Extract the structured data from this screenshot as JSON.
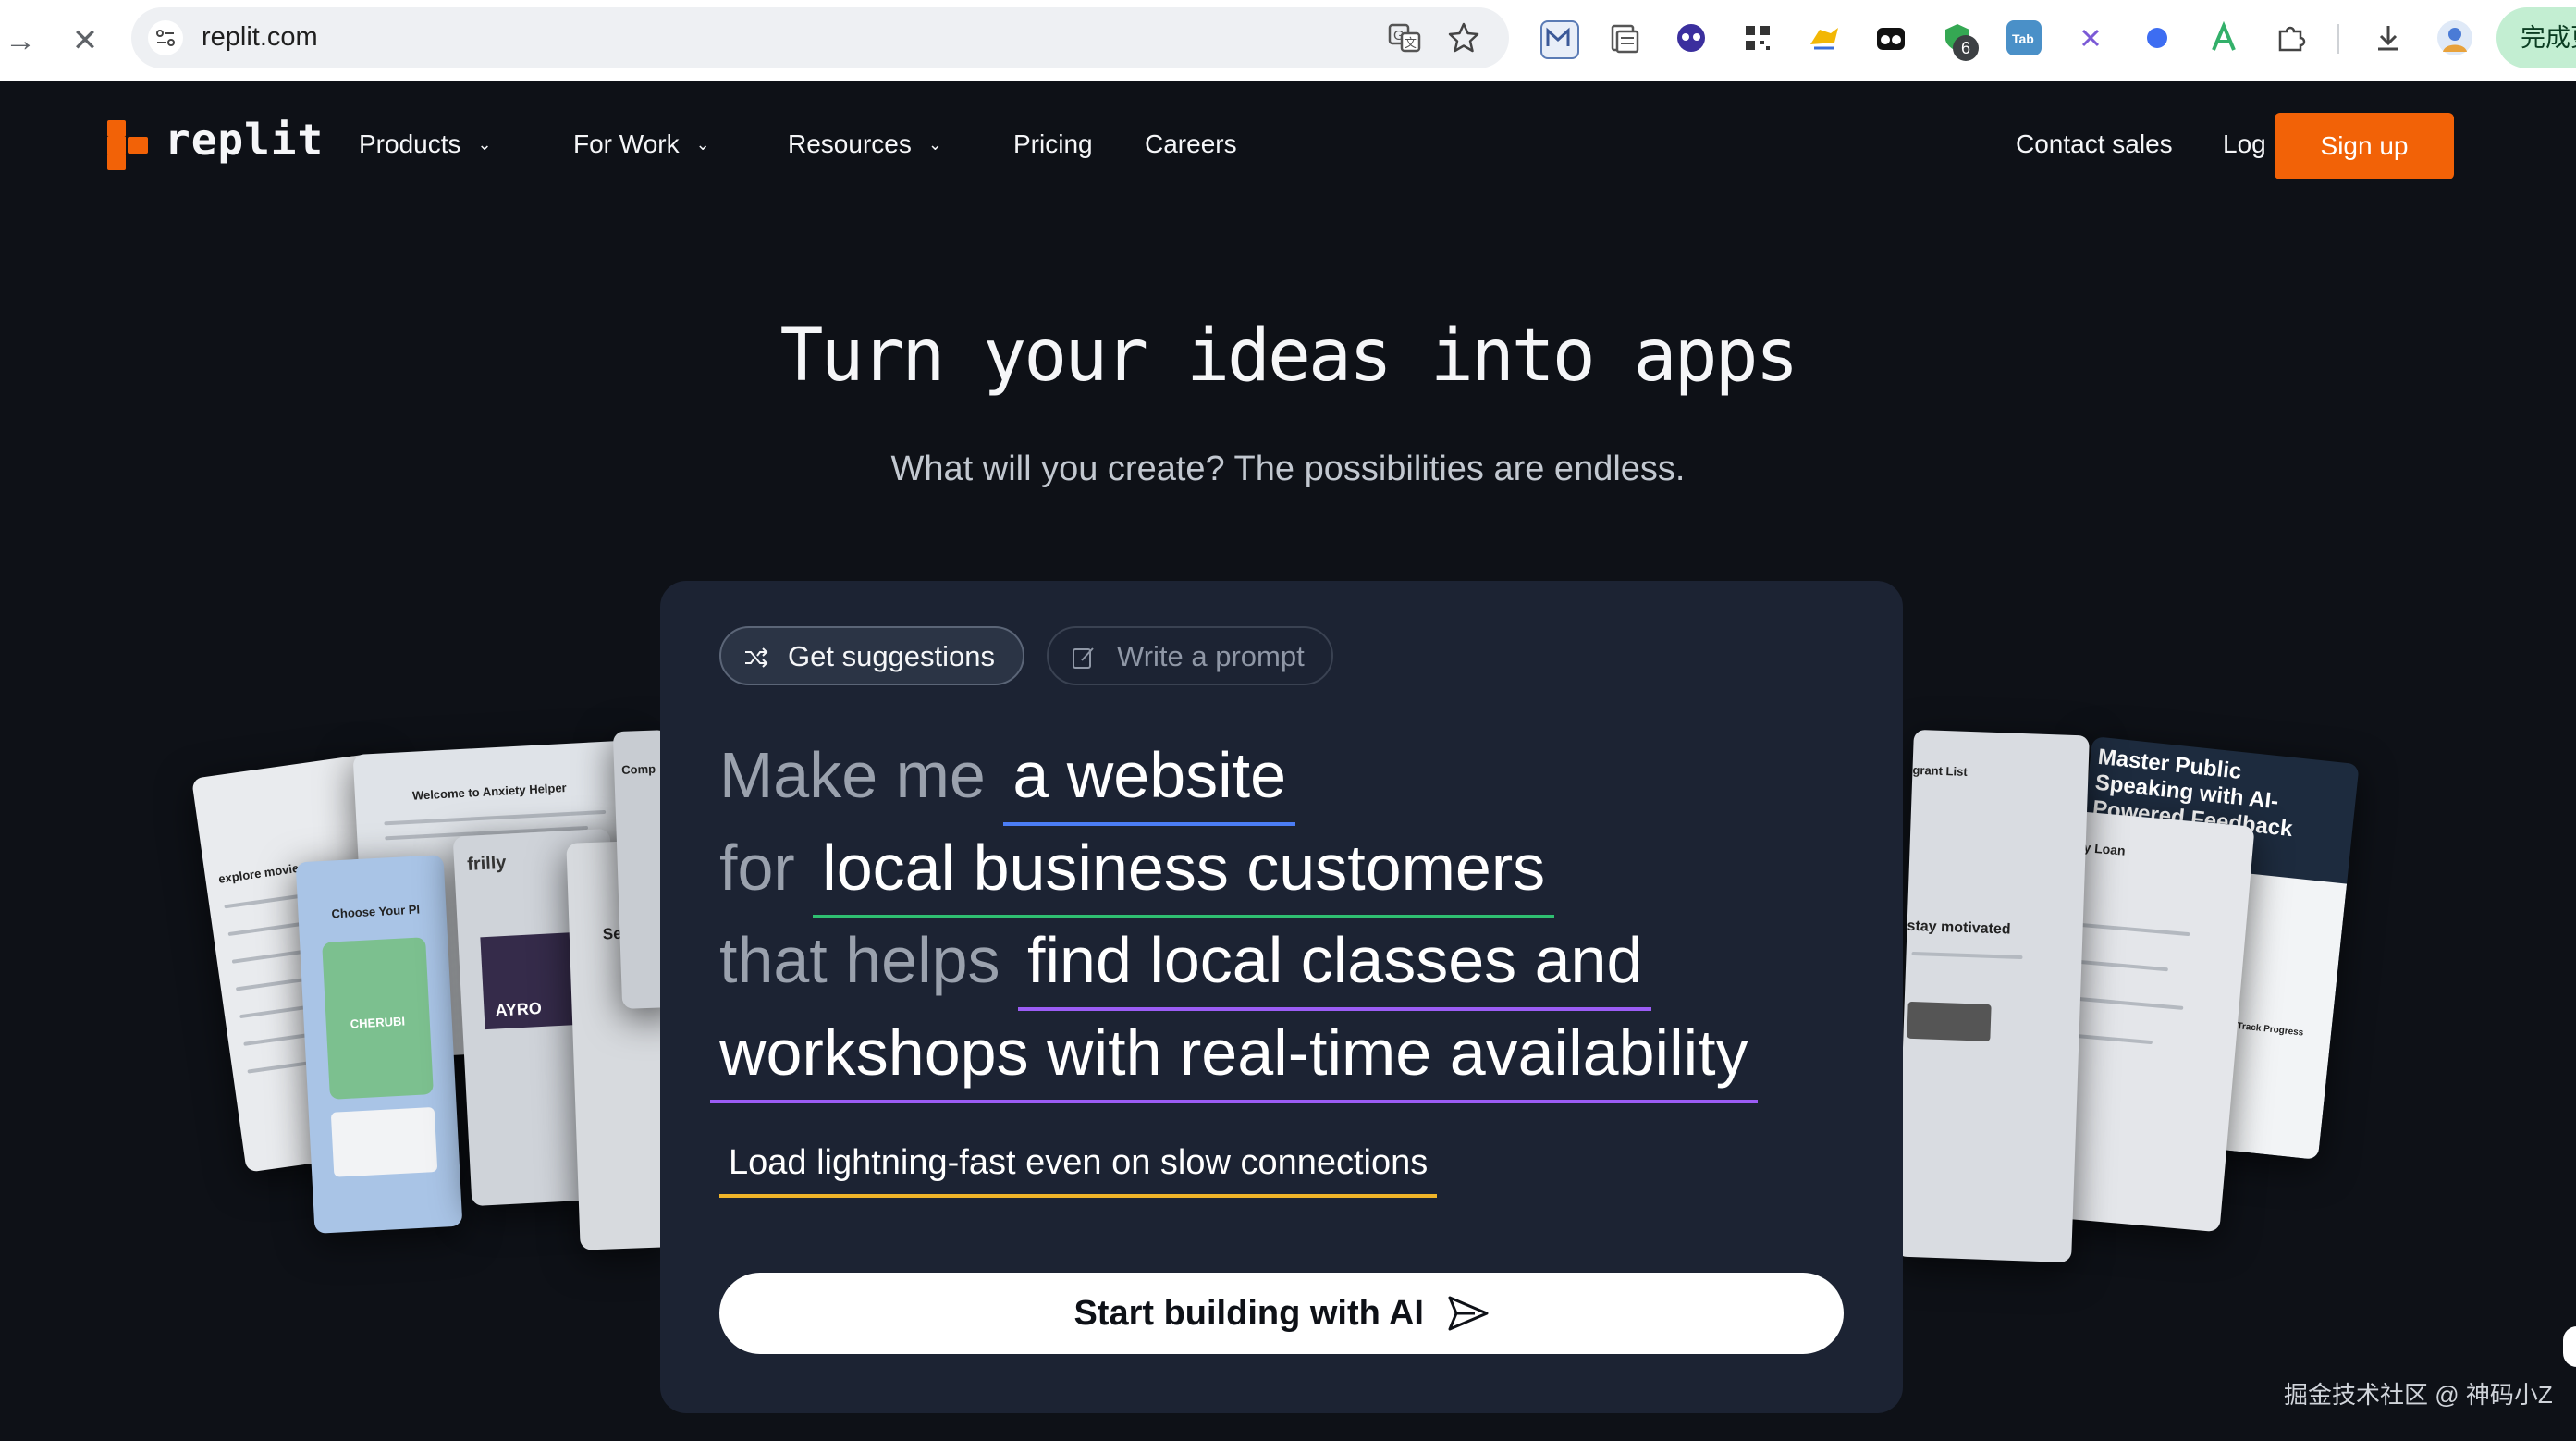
{
  "browser": {
    "url": "replit.com",
    "right_button_label": "完成更",
    "extension_badge": "6",
    "extensions": [
      "gmail-m-icon",
      "reader-icon",
      "bot-face-icon",
      "qr-code-icon",
      "yellow-bird-icon",
      "glasses-icon",
      "green-shield-icon",
      "tab-icon",
      "x-icon",
      "blue-dot-icon",
      "green-a-icon",
      "puzzle-icon",
      "download-icon",
      "avatar-icon"
    ]
  },
  "header": {
    "brand": "replit",
    "nav": [
      {
        "label": "Products",
        "dropdown": true
      },
      {
        "label": "For Work",
        "dropdown": true
      },
      {
        "label": "Resources",
        "dropdown": true
      },
      {
        "label": "Pricing",
        "dropdown": false
      },
      {
        "label": "Careers",
        "dropdown": false
      }
    ],
    "contact_sales": "Contact sales",
    "login": "Log in",
    "signup": "Sign up"
  },
  "hero": {
    "title": "Turn your ideas into apps",
    "subtitle": "What will you create? The possibilities are endless."
  },
  "prompt": {
    "chips": {
      "active": "Get suggestions",
      "idle": "Write a prompt"
    },
    "line1_prefix": "Make me",
    "line1_value": "a website",
    "line2_prefix": "for",
    "line2_value": "local business customers",
    "line3_prefix": "that helps",
    "line3_value": "find local classes and",
    "line4_value": "workshops with real-time availability",
    "requirement": "Load lightning-fast even on slow connections",
    "cta": "Start building with AI"
  },
  "preview_cards": {
    "left": [
      "Welcome to Anxiety Helper",
      "explore movies",
      "frilly",
      "AYRO",
      "See pr",
      "Comp",
      "CHERUBI",
      "Choose Your Pl"
    ],
    "right": [
      "Master Public Speaking with AI-Powered Feedback",
      "Single Property Loan Calculator",
      "stay motivated",
      "grant List",
      "Track Progress"
    ]
  },
  "watermark": "掘金技术社区 @ 神码小Z",
  "colors": {
    "background": "#0e1117",
    "panel": "#1c2333",
    "accent": "#f26207",
    "underline_blue": "#4b7df5",
    "underline_green": "#2fbf71",
    "underline_purple": "#9b5cf5",
    "underline_yellow": "#f0b429"
  }
}
